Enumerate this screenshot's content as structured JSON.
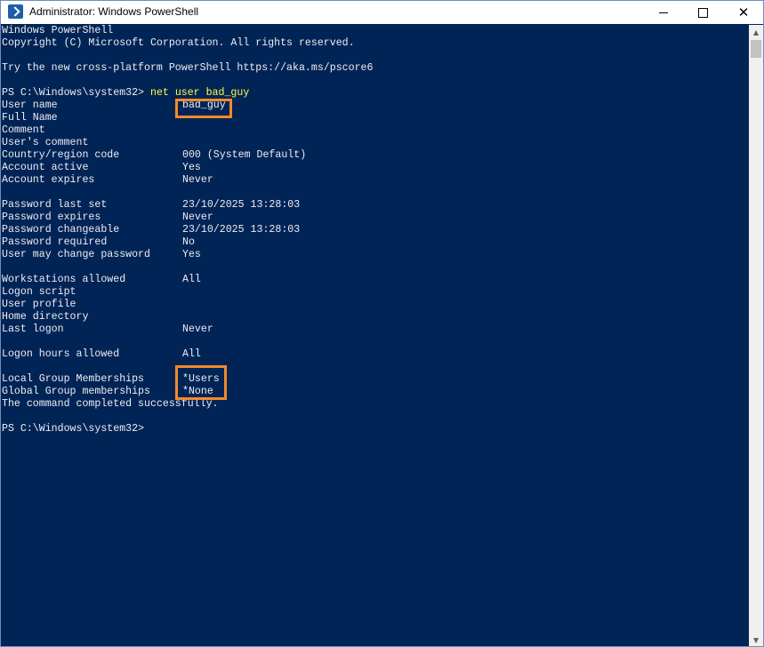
{
  "window": {
    "title": "Administrator: Windows PowerShell",
    "icon": "powershell-icon",
    "controls": {
      "minimize": "minimize-icon",
      "maximize": "maximize-icon",
      "close": "close-icon"
    }
  },
  "console": {
    "banner": [
      "Windows PowerShell",
      "Copyright (C) Microsoft Corporation. All rights reserved.",
      "",
      "Try the new cross-platform PowerShell https://aka.ms/pscore6"
    ],
    "prompt": "PS C:\\Windows\\system32> ",
    "command": "net user bad_guy",
    "fields": [
      {
        "label": "User name",
        "value": "bad_guy"
      },
      {
        "label": "Full Name",
        "value": ""
      },
      {
        "label": "Comment",
        "value": ""
      },
      {
        "label": "User's comment",
        "value": ""
      },
      {
        "label": "Country/region code",
        "value": "000 (System Default)"
      },
      {
        "label": "Account active",
        "value": "Yes"
      },
      {
        "label": "Account expires",
        "value": "Never"
      },
      {
        "label": "",
        "value": ""
      },
      {
        "label": "Password last set",
        "value": "23/10/2025 13:28:03"
      },
      {
        "label": "Password expires",
        "value": "Never"
      },
      {
        "label": "Password changeable",
        "value": "23/10/2025 13:28:03"
      },
      {
        "label": "Password required",
        "value": "No"
      },
      {
        "label": "User may change password",
        "value": "Yes"
      },
      {
        "label": "",
        "value": ""
      },
      {
        "label": "Workstations allowed",
        "value": "All"
      },
      {
        "label": "Logon script",
        "value": ""
      },
      {
        "label": "User profile",
        "value": ""
      },
      {
        "label": "Home directory",
        "value": ""
      },
      {
        "label": "Last logon",
        "value": "Never"
      },
      {
        "label": "",
        "value": ""
      },
      {
        "label": "Logon hours allowed",
        "value": "All"
      },
      {
        "label": "",
        "value": ""
      },
      {
        "label": "Local Group Memberships",
        "value": "*Users"
      },
      {
        "label": "Global Group memberships",
        "value": "*None"
      }
    ],
    "completion": "The command completed successfully.",
    "final_prompt": "PS C:\\Windows\\system32>"
  },
  "colors": {
    "background": "#012456",
    "text": "#eeedf0",
    "command": "#fefe4d",
    "highlight": "#f28a2a"
  }
}
